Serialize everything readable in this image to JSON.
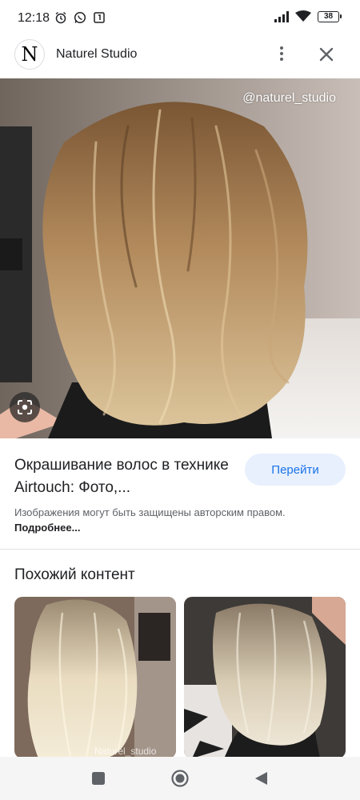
{
  "status": {
    "time": "12:18",
    "battery": "38",
    "icons_left": [
      "alarm-icon",
      "whatsapp-icon",
      "notification-icon"
    ],
    "icons_right": [
      "signal-icon",
      "wifi-icon",
      "battery-icon"
    ]
  },
  "header": {
    "logo_letter": "N",
    "site_name": "Naturel Studio",
    "more_icon": "more-vert-icon",
    "close_icon": "close-icon"
  },
  "main_image": {
    "watermark": "@naturel_studio",
    "lens_icon": "google-lens-icon"
  },
  "info": {
    "title": "Окрашивание волос в технике Airtouch: Фото,...",
    "goto_label": "Перейти",
    "copyright_text": "Изображения могут быть защищены авторским правом.",
    "copyright_link": "Подробнее..."
  },
  "similar": {
    "heading": "Похожий контент",
    "items": [
      {
        "watermark": "Naturel_studio"
      },
      {
        "watermark": ""
      }
    ]
  },
  "nav": {
    "buttons": [
      "recents-icon",
      "home-icon",
      "back-icon"
    ]
  },
  "colors": {
    "accent": "#1a73e8",
    "button_bg": "#e8f0fe",
    "text": "#202124",
    "secondary_text": "#5f6368"
  }
}
